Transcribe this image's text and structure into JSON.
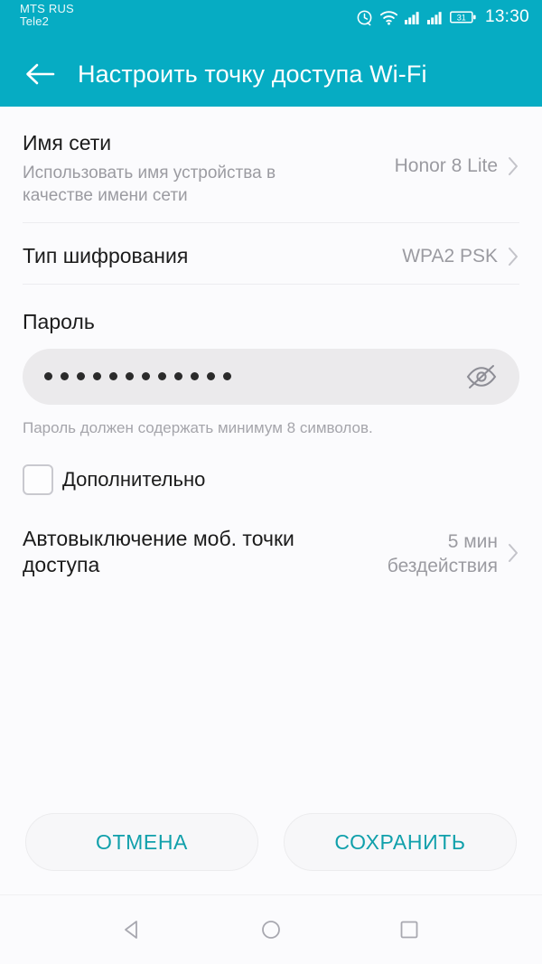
{
  "statusbar": {
    "carrier_primary": "MTS RUS",
    "carrier_secondary": "Tele2",
    "icons": [
      "alarm-icon",
      "wifi-hotspot-icon",
      "signal-bars-icon",
      "signal-bars-icon",
      "battery-icon"
    ],
    "battery_level": "31",
    "clock": "13:30"
  },
  "appbar": {
    "back_icon": "arrow-left-icon",
    "title": "Настроить точку доступа Wi-Fi",
    "bg_color": "#06acc3"
  },
  "settings": {
    "network_name": {
      "title": "Имя сети",
      "subtitle": "Использовать имя устройства в качестве имени сети",
      "value": "Honor 8 Lite"
    },
    "encryption": {
      "title": "Тип шифрования",
      "value": "WPA2 PSK"
    },
    "password": {
      "label": "Пароль",
      "masked_value": "••••••••••••",
      "dot_count": 12,
      "visibility_icon": "eye-off-icon",
      "hint": "Пароль должен содержать минимум 8 символов."
    },
    "advanced": {
      "label": "Дополнительно",
      "checked": false
    },
    "auto_off": {
      "title": "Автовыключение моб. точки доступа",
      "value_line1": "5 мин",
      "value_line2": "бездействия"
    }
  },
  "actions": {
    "cancel_label": "ОТМЕНА",
    "save_label": "СОХРАНИТЬ",
    "accent_color": "#11a0ab"
  },
  "navbar": {
    "back_icon": "nav-back-triangle-icon",
    "home_icon": "nav-home-circle-icon",
    "recents_icon": "nav-recents-square-icon"
  }
}
